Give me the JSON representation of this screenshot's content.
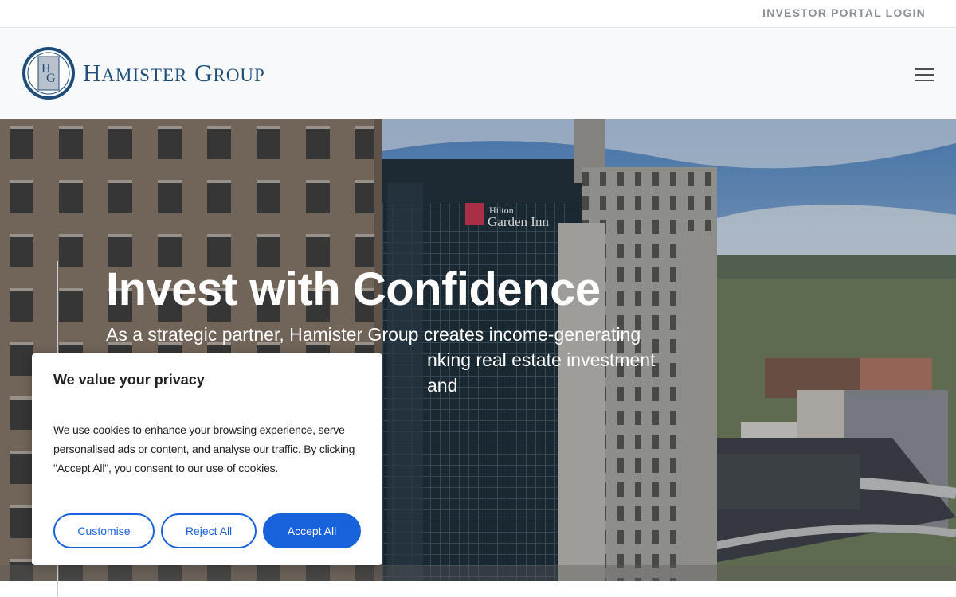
{
  "topbar": {
    "portal_link": "INVESTOR PORTAL LOGIN"
  },
  "header": {
    "logo_monogram": "HG",
    "logo_word1_initial": "H",
    "logo_word1_rest": "AMISTER",
    "logo_word2_initial": "G",
    "logo_word2_rest": "ROUP",
    "menu_icon": "hamburger-menu-icon"
  },
  "hero": {
    "title": "Invest with Confidence",
    "subtitle": "As a strategic partner, Hamister Group creates income-generating ... nking real estate investment and",
    "subtitle_visible_line1": "As a strategic partner, Hamister Group creates income-generating",
    "subtitle_visible_line2": "nking real estate investment and",
    "sign_brand": "Hilton",
    "sign_name": "Garden Inn"
  },
  "cookie": {
    "title": "We value your privacy",
    "text": "We use cookies to enhance your browsing experience, serve personalised ads or content, and analyse our traffic. By clicking \"Accept All\", you consent to our use of cookies.",
    "customise": "Customise",
    "reject": "Reject All",
    "accept": "Accept All"
  },
  "colors": {
    "brand_navy": "#1f4d7a",
    "accent_blue": "#1863dc",
    "header_bg": "#f8f9fb"
  }
}
